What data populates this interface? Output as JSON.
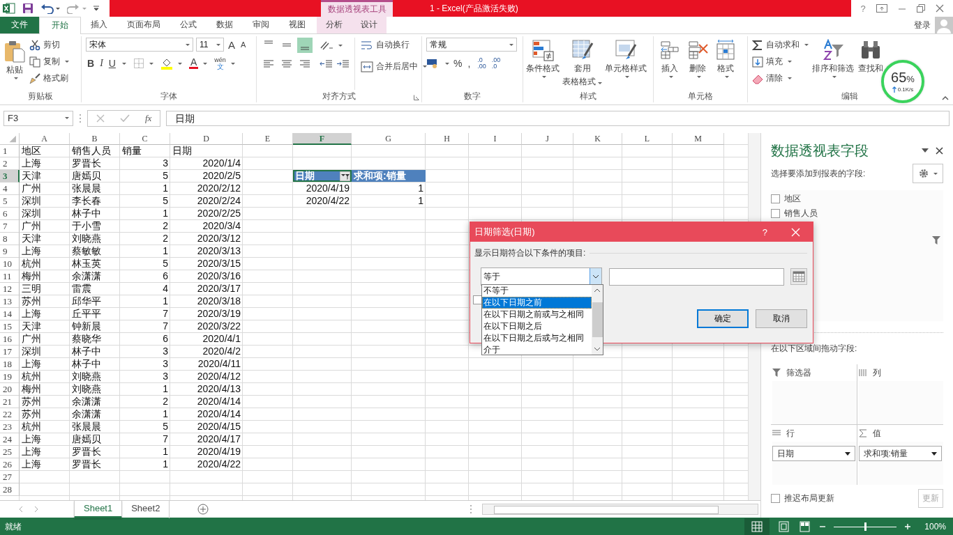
{
  "title_bar": {
    "context_label": "数据透视表工具",
    "title": "1 -  Excel(产品激活失败)",
    "help": "?"
  },
  "tabs": [
    {
      "label": "文件",
      "kind": "file",
      "selected": false
    },
    {
      "label": "开始",
      "kind": "normal",
      "selected": true
    },
    {
      "label": "插入",
      "kind": "normal",
      "selected": false
    },
    {
      "label": "页面布局",
      "kind": "normal",
      "selected": false
    },
    {
      "label": "公式",
      "kind": "normal",
      "selected": false
    },
    {
      "label": "数据",
      "kind": "normal",
      "selected": false
    },
    {
      "label": "审阅",
      "kind": "normal",
      "selected": false
    },
    {
      "label": "视图",
      "kind": "normal",
      "selected": false
    },
    {
      "label": "分析",
      "kind": "context",
      "selected": false
    },
    {
      "label": "设计",
      "kind": "context",
      "selected": false
    }
  ],
  "account": {
    "label": "登录"
  },
  "ribbon": {
    "clipboard": {
      "paste": "粘贴",
      "cut": "剪切",
      "copy": "复制",
      "painter": "格式刷",
      "label": "剪贴板"
    },
    "font": {
      "name": "宋体",
      "size": "11",
      "grow": "A",
      "shrink": "A",
      "bold": "B",
      "italic": "I",
      "underline": "U",
      "font_color": "A",
      "phonetic_top": "wén",
      "phonetic_bottom": "文",
      "label": "字体"
    },
    "alignment": {
      "vertical": [
        {
          "selected": false
        },
        {
          "selected": false
        },
        {
          "selected": true
        }
      ],
      "wrap": "自动换行",
      "merge": "合并后居中",
      "label": "对齐方式"
    },
    "number": {
      "format": "常规",
      "percent": "%",
      "comma": ",",
      "decimals": [
        {
          "top": ".0",
          "bottom": ".00"
        },
        {
          "top": ".00",
          "bottom": ".0"
        }
      ],
      "label": "数字"
    },
    "styles": {
      "conditional": "条件格式",
      "table_top": "套用",
      "table_bottom": "表格格式",
      "cell_styles": "单元格样式",
      "label": "样式"
    },
    "cells": {
      "insert": "插入",
      "delete": "删除",
      "format": "格式",
      "label": "单元格"
    },
    "editing": {
      "autosum": "自动求和",
      "fill": "填充",
      "clear": "清除",
      "sort": "排序和筛选",
      "find": "查找和",
      "label": "编辑"
    }
  },
  "speed_widget": {
    "percent": "65",
    "unit": "%",
    "speed": "0.1K/s"
  },
  "formula_bar": {
    "name_box": "F3",
    "fx": "fx",
    "content": "日期"
  },
  "sheet": {
    "columns": [
      {
        "label": "A",
        "selected": false
      },
      {
        "label": "B",
        "selected": false
      },
      {
        "label": "C",
        "selected": false
      },
      {
        "label": "D",
        "selected": false
      },
      {
        "label": "E",
        "selected": false
      },
      {
        "label": "F",
        "selected": true
      },
      {
        "label": "G",
        "selected": false
      },
      {
        "label": "H",
        "selected": false
      },
      {
        "label": "I",
        "selected": false
      },
      {
        "label": "J",
        "selected": false
      },
      {
        "label": "K",
        "selected": false
      },
      {
        "label": "L",
        "selected": false
      },
      {
        "label": "M",
        "selected": false
      }
    ],
    "rows": [
      {
        "label": "1",
        "selected": false,
        "cells": [
          "地区",
          "销售人员",
          "销量",
          "日期"
        ]
      },
      {
        "label": "2",
        "selected": false,
        "cells": [
          "上海",
          "罗晋长",
          "3",
          "2020/1/4"
        ]
      },
      {
        "label": "3",
        "selected": true,
        "cells": [
          "天津",
          "唐嫣贝",
          "5",
          "2020/2/5"
        ]
      },
      {
        "label": "4",
        "selected": false,
        "cells": [
          "广州",
          "张晨晨",
          "1",
          "2020/2/12"
        ]
      },
      {
        "label": "5",
        "selected": false,
        "cells": [
          "深圳",
          "李长春",
          "5",
          "2020/2/24"
        ]
      },
      {
        "label": "6",
        "selected": false,
        "cells": [
          "深圳",
          "林子中",
          "1",
          "2020/2/25"
        ]
      },
      {
        "label": "7",
        "selected": false,
        "cells": [
          "广州",
          "于小雪",
          "2",
          "2020/3/4"
        ]
      },
      {
        "label": "8",
        "selected": false,
        "cells": [
          "天津",
          "刘晓燕",
          "2",
          "2020/3/12"
        ]
      },
      {
        "label": "9",
        "selected": false,
        "cells": [
          "上海",
          "蔡敏敏",
          "1",
          "2020/3/13"
        ]
      },
      {
        "label": "10",
        "selected": false,
        "cells": [
          "杭州",
          "林玉英",
          "5",
          "2020/3/15"
        ]
      },
      {
        "label": "11",
        "selected": false,
        "cells": [
          "梅州",
          "余潇潇",
          "6",
          "2020/3/16"
        ]
      },
      {
        "label": "12",
        "selected": false,
        "cells": [
          "三明",
          "雷震",
          "4",
          "2020/3/17"
        ]
      },
      {
        "label": "13",
        "selected": false,
        "cells": [
          "苏州",
          "邱华平",
          "1",
          "2020/3/18"
        ]
      },
      {
        "label": "14",
        "selected": false,
        "cells": [
          "上海",
          "丘平平",
          "7",
          "2020/3/19"
        ]
      },
      {
        "label": "15",
        "selected": false,
        "cells": [
          "天津",
          "钟新晨",
          "7",
          "2020/3/22"
        ]
      },
      {
        "label": "16",
        "selected": false,
        "cells": [
          "广州",
          "蔡晓华",
          "6",
          "2020/4/1"
        ]
      },
      {
        "label": "17",
        "selected": false,
        "cells": [
          "深圳",
          "林子中",
          "3",
          "2020/4/2"
        ]
      },
      {
        "label": "18",
        "selected": false,
        "cells": [
          "上海",
          "林子中",
          "3",
          "2020/4/11"
        ]
      },
      {
        "label": "19",
        "selected": false,
        "cells": [
          "杭州",
          "刘晓燕",
          "3",
          "2020/4/12"
        ]
      },
      {
        "label": "20",
        "selected": false,
        "cells": [
          "梅州",
          "刘晓燕",
          "1",
          "2020/4/13"
        ]
      },
      {
        "label": "21",
        "selected": false,
        "cells": [
          "苏州",
          "余潇潇",
          "2",
          "2020/4/14"
        ]
      },
      {
        "label": "22",
        "selected": false,
        "cells": [
          "苏州",
          "余潇潇",
          "1",
          "2020/4/14"
        ]
      },
      {
        "label": "23",
        "selected": false,
        "cells": [
          "杭州",
          "张晨晨",
          "5",
          "2020/4/15"
        ]
      },
      {
        "label": "24",
        "selected": false,
        "cells": [
          "上海",
          "唐嫣贝",
          "7",
          "2020/4/17"
        ]
      },
      {
        "label": "25",
        "selected": false,
        "cells": [
          "上海",
          "罗晋长",
          "1",
          "2020/4/19"
        ]
      },
      {
        "label": "26",
        "selected": false,
        "cells": [
          "上海",
          "罗晋长",
          "1",
          "2020/4/22"
        ]
      },
      {
        "label": "27",
        "selected": false
      },
      {
        "label": "28",
        "selected": false
      }
    ],
    "pivot": {
      "row_label": "日期",
      "value_label": "求和项:销量",
      "rows": [
        {
          "label": "2020/4/19",
          "value": "1"
        },
        {
          "label": "2020/4/22",
          "value": "1"
        }
      ]
    }
  },
  "sheet_tabs": [
    {
      "label": "Sheet1",
      "selected": true
    },
    {
      "label": "Sheet2",
      "selected": false
    }
  ],
  "field_panel": {
    "title": "数据透视表字段",
    "prompt": "选择要添加到报表的字段:",
    "fields": [
      {
        "label": "地区",
        "checked": false
      },
      {
        "label": "销售人员",
        "checked": false
      }
    ],
    "drag_prompt": "在以下区域间拖动字段:",
    "areas": {
      "filters": "筛选器",
      "columns": "列",
      "rows": "行",
      "values": "值",
      "row_item": "日期",
      "value_item": "求和项:销量"
    },
    "defer": {
      "label": "推迟布局更新",
      "checked": false
    },
    "update": {
      "label": "更新",
      "disabled": true
    }
  },
  "dialog": {
    "title": "日期筛选(日期)",
    "help": "?",
    "prompt": "显示日期符合以下条件的项目:",
    "operator": "等于",
    "checkbox": {
      "checked": false
    },
    "options": [
      {
        "label": "不等于",
        "selected": false
      },
      {
        "label": "在以下日期之前",
        "selected": true
      },
      {
        "label": "在以下日期之前或与之相同",
        "selected": false
      },
      {
        "label": "在以下日期之后",
        "selected": false
      },
      {
        "label": "在以下日期之后或与之相同",
        "selected": false
      },
      {
        "label": "介于",
        "selected": false
      }
    ],
    "ok": "确定",
    "cancel": "取消"
  },
  "status_bar": {
    "ready": "就绪",
    "zoom": "100%",
    "level": 0.5
  }
}
